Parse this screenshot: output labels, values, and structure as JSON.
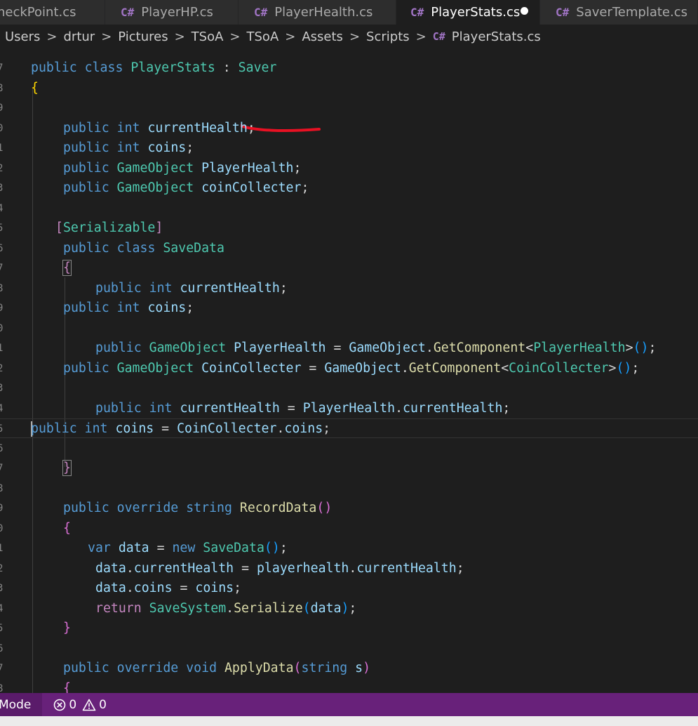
{
  "tabs": [
    {
      "label": "heckPoint.cs",
      "icon": "csharp-file-icon",
      "active": false
    },
    {
      "label": "PlayerHP.cs",
      "icon": "csharp-file-icon",
      "active": false
    },
    {
      "label": "PlayerHealth.cs",
      "icon": "csharp-file-icon",
      "active": false
    },
    {
      "label": "PlayerStats.cs",
      "icon": "csharp-file-icon",
      "active": true,
      "modified": true
    },
    {
      "label": "SaverTemplate.cs",
      "icon": "csharp-file-icon",
      "active": false
    }
  ],
  "breadcrumb": [
    "Users",
    "drtur",
    "Pictures",
    "TSoA",
    "TSoA",
    "Assets",
    "Scripts",
    "PlayerStats.cs"
  ],
  "line_numbers": [
    "7",
    "8",
    "9",
    "0",
    "1",
    "2",
    "3",
    "4",
    "5",
    "6",
    "7",
    "8",
    "9",
    "0",
    "1",
    "2",
    "3",
    "4",
    "5",
    "6",
    "7",
    "8",
    "9",
    "0",
    "1",
    "2",
    "3",
    "4",
    "5",
    "6",
    "7",
    "8"
  ],
  "colors": {
    "editor_bg": "#1e1e1e",
    "keyword": "#569cd6",
    "type": "#4ec9b0",
    "function": "#dcdcaa",
    "variable": "#9cdcfe",
    "control": "#c586c0",
    "annotation_underline": "#e81123",
    "statusbar_bg": "#68217a"
  },
  "statusbar": {
    "mode": "Mode",
    "errors_icon": "error-circle-icon",
    "errors": "0",
    "warnings_icon": "warning-triangle-icon",
    "warnings": "0"
  }
}
